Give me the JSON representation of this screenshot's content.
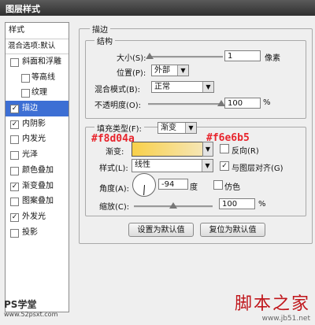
{
  "window": {
    "title": "图层样式"
  },
  "left_panel": {
    "header": "样式",
    "blend_options": "混合选项:默认",
    "items": [
      {
        "label": "斜面和浮雕",
        "checked": false,
        "indent": false,
        "selected": false
      },
      {
        "label": "等高线",
        "checked": false,
        "indent": true,
        "selected": false
      },
      {
        "label": "纹理",
        "checked": false,
        "indent": true,
        "selected": false
      },
      {
        "label": "描边",
        "checked": true,
        "indent": false,
        "selected": true
      },
      {
        "label": "内阴影",
        "checked": true,
        "indent": false,
        "selected": false
      },
      {
        "label": "内发光",
        "checked": false,
        "indent": false,
        "selected": false
      },
      {
        "label": "光泽",
        "checked": false,
        "indent": false,
        "selected": false
      },
      {
        "label": "颜色叠加",
        "checked": false,
        "indent": false,
        "selected": false
      },
      {
        "label": "渐变叠加",
        "checked": true,
        "indent": false,
        "selected": false
      },
      {
        "label": "图案叠加",
        "checked": false,
        "indent": false,
        "selected": false
      },
      {
        "label": "外发光",
        "checked": true,
        "indent": false,
        "selected": false
      },
      {
        "label": "投影",
        "checked": false,
        "indent": false,
        "selected": false
      }
    ]
  },
  "stroke": {
    "section_title": "描边",
    "structure_title": "结构",
    "size_label": "大小(S):",
    "size_value": "1",
    "size_unit": "像素",
    "size_level": 0.02,
    "position_label": "位置(P):",
    "position_value": "外部",
    "blend_label": "混合模式(B):",
    "blend_value": "正常",
    "opacity_label": "不透明度(O):",
    "opacity_value": "100",
    "opacity_level": 1.0,
    "percent": "%"
  },
  "fill": {
    "fill_type_label": "填充类型(F):",
    "fill_type_value": "渐变",
    "gradient_label": "渐变:",
    "reverse_label": "反向(R)",
    "style_label": "样式(L):",
    "style_value": "线性",
    "align_label": "与图层对齐(G)",
    "align_checked": true,
    "angle_label": "角度(A):",
    "angle_value": "-94",
    "angle_unit": "度",
    "dither_label": "仿色",
    "scale_label": "缩放(C):",
    "scale_value": "100",
    "scale_level": 0.5,
    "percent": "%"
  },
  "annotations": {
    "color_left": "#f8d04a",
    "color_right": "#f6e6b5"
  },
  "colors": {
    "gradient_start": "#f8d04a",
    "gradient_end": "#f6e6b5",
    "accent": "#3d6fd4",
    "annotation": "#e8242c"
  },
  "buttons": {
    "set_default": "设置为默认值",
    "reset_default": "复位为默认值"
  },
  "watermarks": {
    "left": "PS学堂",
    "left_url": "www.52psxt.com",
    "right": "脚本之家",
    "right_url": "www.jb51.net"
  }
}
